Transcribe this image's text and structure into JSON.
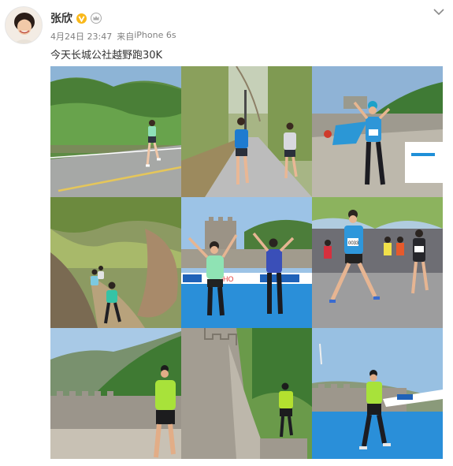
{
  "post": {
    "username": "张欣",
    "date": "4月24日 23:47",
    "source_prefix": "来自",
    "source": "iPhone 6s",
    "text": "今天长城公社越野跑30K"
  },
  "icons": {
    "verified": "verified-v-icon",
    "member": "crown-icon",
    "menu": "chevron-down-icon"
  },
  "photos": {
    "p5_banner": "SOHO",
    "p6_bib": "0033",
    "p7_bib": "",
    "p8_bib": ""
  },
  "colors": {
    "verified": "#f9b81a",
    "sky": "#8fc0e8",
    "grass": "#4e8a3a",
    "track_blue": "#1f8fd8"
  }
}
